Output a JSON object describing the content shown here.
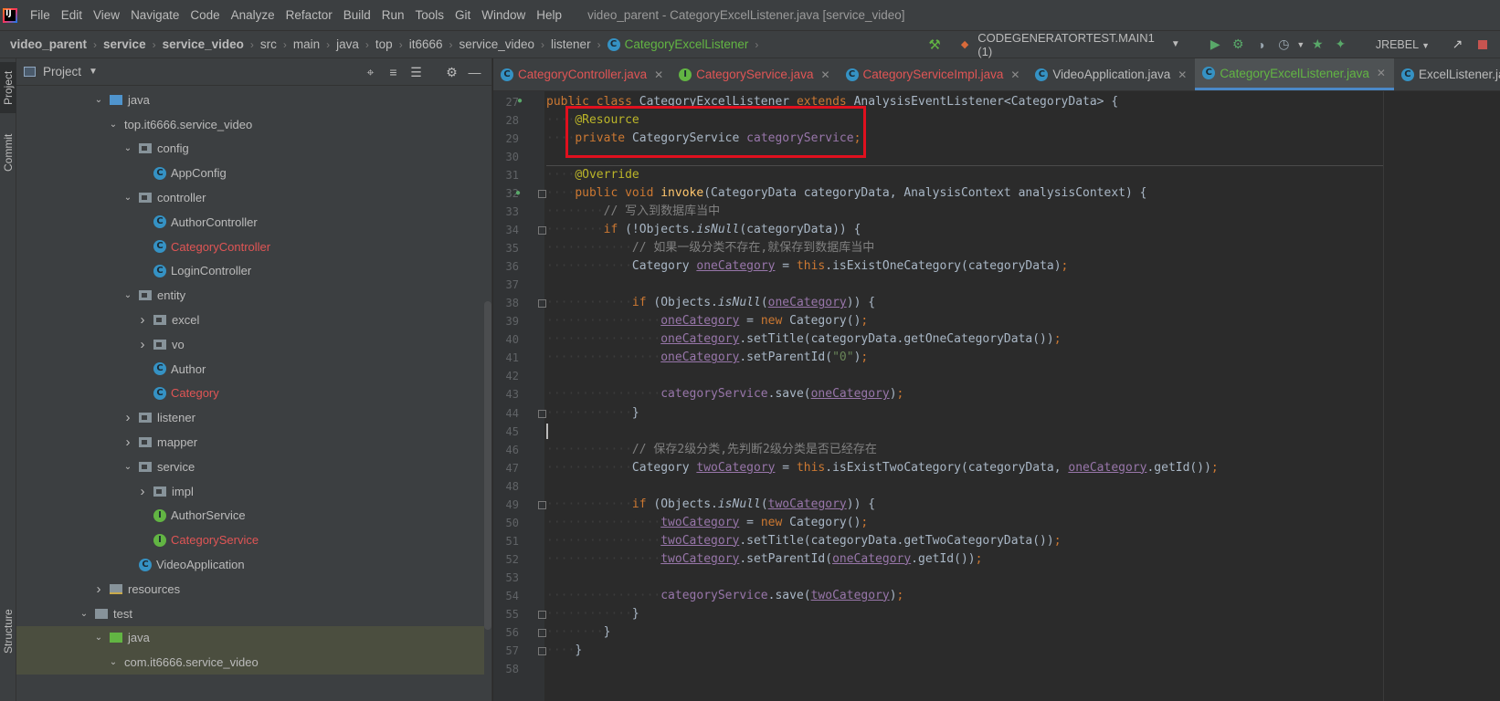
{
  "menubar": {
    "logo_text": "IJ",
    "items": [
      "File",
      "Edit",
      "View",
      "Navigate",
      "Code",
      "Analyze",
      "Refactor",
      "Build",
      "Run",
      "Tools",
      "Git",
      "Window",
      "Help"
    ],
    "window_title": "video_parent - CategoryExcelListener.java [service_video]"
  },
  "navbar": {
    "breadcrumbs": [
      "video_parent",
      "service",
      "service_video",
      "src",
      "main",
      "java",
      "top",
      "it6666",
      "service_video",
      "listener"
    ],
    "current": "CategoryExcelListener",
    "run_config": "CODEGENERATORTEST.MAIN1 (1)",
    "jrebel": "JREBEL"
  },
  "left_strip": {
    "project_tab": "Project",
    "commit_tab": "Commit",
    "structure_tab": "Structure"
  },
  "project": {
    "title": "Project",
    "tree": [
      {
        "label": "java",
        "indent": 0,
        "arrow": "down",
        "icon": "folder-src"
      },
      {
        "label": "top.it6666.service_video",
        "indent": 1,
        "arrow": "down",
        "icon": "none"
      },
      {
        "label": "config",
        "indent": 2,
        "arrow": "down",
        "icon": "package"
      },
      {
        "label": "AppConfig",
        "indent": 3,
        "arrow": "",
        "icon": "class"
      },
      {
        "label": "controller",
        "indent": 2,
        "arrow": "down",
        "icon": "package"
      },
      {
        "label": "AuthorController",
        "indent": 3,
        "arrow": "",
        "icon": "class"
      },
      {
        "label": "CategoryController",
        "indent": 3,
        "arrow": "",
        "icon": "class",
        "red": true
      },
      {
        "label": "LoginController",
        "indent": 3,
        "arrow": "",
        "icon": "class"
      },
      {
        "label": "entity",
        "indent": 2,
        "arrow": "down",
        "icon": "package"
      },
      {
        "label": "excel",
        "indent": 3,
        "arrow": "right",
        "icon": "package"
      },
      {
        "label": "vo",
        "indent": 3,
        "arrow": "right",
        "icon": "package"
      },
      {
        "label": "Author",
        "indent": 3,
        "arrow": "",
        "icon": "class"
      },
      {
        "label": "Category",
        "indent": 3,
        "arrow": "",
        "icon": "class",
        "red": true
      },
      {
        "label": "listener",
        "indent": 2,
        "arrow": "right",
        "icon": "package"
      },
      {
        "label": "mapper",
        "indent": 2,
        "arrow": "right",
        "icon": "package"
      },
      {
        "label": "service",
        "indent": 2,
        "arrow": "down",
        "icon": "package"
      },
      {
        "label": "impl",
        "indent": 3,
        "arrow": "right",
        "icon": "package"
      },
      {
        "label": "AuthorService",
        "indent": 3,
        "arrow": "",
        "icon": "interface"
      },
      {
        "label": "CategoryService",
        "indent": 3,
        "arrow": "",
        "icon": "interface",
        "red": true
      },
      {
        "label": "VideoApplication",
        "indent": 2,
        "arrow": "",
        "icon": "app",
        "shift": true
      },
      {
        "label": "resources",
        "indent": 0,
        "arrow": "right",
        "icon": "folder-res"
      },
      {
        "label": "test",
        "indent": -1,
        "arrow": "down",
        "icon": "folder"
      },
      {
        "label": "java",
        "indent": 0,
        "arrow": "down",
        "icon": "folder-test",
        "selected": true
      },
      {
        "label": "com.it6666.service_video",
        "indent": 1,
        "arrow": "down",
        "icon": "none",
        "selected": true
      }
    ]
  },
  "tabs": [
    {
      "label": "CategoryController.java",
      "icon": "class",
      "color": "red"
    },
    {
      "label": "CategoryService.java",
      "icon": "interface",
      "color": "red"
    },
    {
      "label": "CategoryServiceImpl.java",
      "icon": "class",
      "color": "red"
    },
    {
      "label": "VideoApplication.java",
      "icon": "app",
      "color": "normal"
    },
    {
      "label": "CategoryExcelListener.java",
      "icon": "class",
      "color": "green",
      "active": true
    },
    {
      "label": "ExcelListener.java",
      "icon": "class",
      "color": "normal",
      "no_close": true
    }
  ],
  "editor": {
    "line_numbers": [
      "27",
      "28",
      "29",
      "30",
      "31",
      "32",
      "33",
      "34",
      "35",
      "36",
      "37",
      "38",
      "39",
      "40",
      "41",
      "42",
      "43",
      "44",
      "45",
      "46",
      "47",
      "48",
      "49",
      "50",
      "51",
      "52",
      "53",
      "54",
      "55",
      "56",
      "57",
      "58"
    ],
    "lines": [
      [
        [
          "kw",
          "public class "
        ],
        [
          "",
          "CategoryExcelListener "
        ],
        [
          "kw",
          "extends "
        ],
        [
          "",
          "AnalysisEventListener<CategoryData> {"
        ]
      ],
      [
        [
          "ws",
          "····"
        ],
        [
          "ann",
          "@Resource"
        ]
      ],
      [
        [
          "ws",
          "····"
        ],
        [
          "kw",
          "private "
        ],
        [
          "",
          "CategoryService "
        ],
        [
          "fld",
          "categoryService"
        ],
        [
          "kw",
          ";"
        ]
      ],
      [],
      [
        [
          "ws",
          "····"
        ],
        [
          "ann",
          "@Override"
        ]
      ],
      [
        [
          "ws",
          "····"
        ],
        [
          "kw",
          "public void "
        ],
        [
          "mth",
          "invoke"
        ],
        [
          "",
          "(CategoryData categoryData, AnalysisContext analysisContext) {"
        ]
      ],
      [
        [
          "ws",
          "········"
        ],
        [
          "cmt",
          "// 写入到数据库当中"
        ]
      ],
      [
        [
          "ws",
          "········"
        ],
        [
          "kw",
          "if "
        ],
        [
          "",
          "(!Objects."
        ],
        [
          "it",
          "isNull"
        ],
        [
          "",
          "(categoryData)) {"
        ]
      ],
      [
        [
          "ws",
          "············"
        ],
        [
          "cmt",
          "// 如果一级分类不存在,就保存到数据库当中"
        ]
      ],
      [
        [
          "ws",
          "············"
        ],
        [
          "",
          "Category "
        ],
        [
          "ul",
          "oneCategory"
        ],
        [
          "",
          " = "
        ],
        [
          "kw",
          "this"
        ],
        [
          "",
          ".isExistOneCategory(categoryData)"
        ],
        [
          "kw",
          ";"
        ]
      ],
      [],
      [
        [
          "ws",
          "············"
        ],
        [
          "kw",
          "if "
        ],
        [
          "",
          "(Objects."
        ],
        [
          "it",
          "isNull"
        ],
        [
          "",
          "("
        ],
        [
          "ul",
          "oneCategory"
        ],
        [
          "",
          ")) {"
        ]
      ],
      [
        [
          "ws",
          "················"
        ],
        [
          "ul",
          "oneCategory"
        ],
        [
          "",
          " = "
        ],
        [
          "kw",
          "new "
        ],
        [
          "",
          "Category()"
        ],
        [
          "kw",
          ";"
        ]
      ],
      [
        [
          "ws",
          "················"
        ],
        [
          "ul",
          "oneCategory"
        ],
        [
          "",
          ".setTitle(categoryData.getOneCategoryData())"
        ],
        [
          "kw",
          ";"
        ]
      ],
      [
        [
          "ws",
          "················"
        ],
        [
          "ul",
          "oneCategory"
        ],
        [
          "",
          ".setParentId("
        ],
        [
          "str",
          "\"0\""
        ],
        [
          "",
          ")"
        ],
        [
          "kw",
          ";"
        ]
      ],
      [],
      [
        [
          "ws",
          "················"
        ],
        [
          "fld",
          "categoryService"
        ],
        [
          "",
          ".save("
        ],
        [
          "ul",
          "oneCategory"
        ],
        [
          "",
          ")"
        ],
        [
          "kw",
          ";"
        ]
      ],
      [
        [
          "ws",
          "············"
        ],
        [
          "",
          "}"
        ]
      ],
      [],
      [
        [
          "ws",
          "············"
        ],
        [
          "cmt",
          "// 保存2级分类,先判断2级分类是否已经存在"
        ]
      ],
      [
        [
          "ws",
          "············"
        ],
        [
          "",
          "Category "
        ],
        [
          "ul",
          "twoCategory"
        ],
        [
          "",
          " = "
        ],
        [
          "kw",
          "this"
        ],
        [
          "",
          ".isExistTwoCategory(categoryData, "
        ],
        [
          "ul",
          "oneCategory"
        ],
        [
          "",
          ".getId())"
        ],
        [
          "kw",
          ";"
        ]
      ],
      [],
      [
        [
          "ws",
          "············"
        ],
        [
          "kw",
          "if "
        ],
        [
          "",
          "(Objects."
        ],
        [
          "it",
          "isNull"
        ],
        [
          "",
          "("
        ],
        [
          "ul",
          "twoCategory"
        ],
        [
          "",
          ")) {"
        ]
      ],
      [
        [
          "ws",
          "················"
        ],
        [
          "ul",
          "twoCategory"
        ],
        [
          "",
          " = "
        ],
        [
          "kw",
          "new "
        ],
        [
          "",
          "Category()"
        ],
        [
          "kw",
          ";"
        ]
      ],
      [
        [
          "ws",
          "················"
        ],
        [
          "ul",
          "twoCategory"
        ],
        [
          "",
          ".setTitle(categoryData.getTwoCategoryData())"
        ],
        [
          "kw",
          ";"
        ]
      ],
      [
        [
          "ws",
          "················"
        ],
        [
          "ul",
          "twoCategory"
        ],
        [
          "",
          ".setParentId("
        ],
        [
          "ul",
          "oneCategory"
        ],
        [
          "",
          ".getId())"
        ],
        [
          "kw",
          ";"
        ]
      ],
      [],
      [
        [
          "ws",
          "················"
        ],
        [
          "fld",
          "categoryService"
        ],
        [
          "",
          ".save("
        ],
        [
          "ul",
          "twoCategory"
        ],
        [
          "",
          ")"
        ],
        [
          "kw",
          ";"
        ]
      ],
      [
        [
          "ws",
          "············"
        ],
        [
          "",
          "}"
        ]
      ],
      [
        [
          "ws",
          "········"
        ],
        [
          "",
          "}"
        ]
      ],
      [
        [
          "ws",
          "····"
        ],
        [
          "",
          "}"
        ]
      ],
      []
    ]
  },
  "colors": {
    "highlight_box": "#e0101e",
    "keyword": "#cc7832",
    "annotation": "#bbb529",
    "field": "#9876aa",
    "method": "#ffc66d",
    "comment": "#808080",
    "string": "#6a8759",
    "modified_file": "#e05555",
    "current_file": "#62b543"
  }
}
